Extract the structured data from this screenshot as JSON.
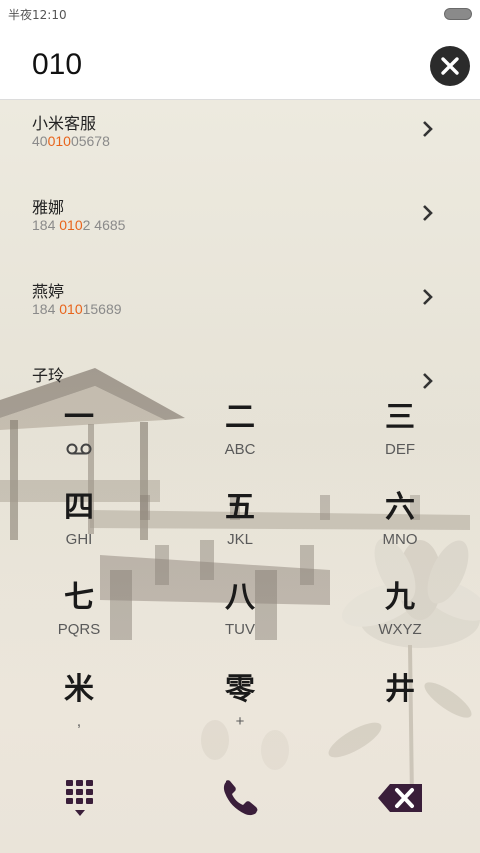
{
  "status_bar": {
    "time": "半夜12:10"
  },
  "dialer": {
    "number": "010"
  },
  "contacts": [
    {
      "name": "小米客服",
      "number_pre": "40",
      "number_hl": "010",
      "number_post": "05678"
    },
    {
      "name": "雅娜",
      "number_pre": "184 ",
      "number_hl": "010",
      "number_post": "2 4685"
    },
    {
      "name": "燕婷",
      "number_pre": "184 ",
      "number_hl": "010",
      "number_post": "15689"
    },
    {
      "name": "子玲",
      "number_pre": "",
      "number_hl": "",
      "number_post": ""
    }
  ],
  "keypad": [
    {
      "glyph": "一",
      "sub": "voicemail-icon"
    },
    {
      "glyph": "二",
      "sub": "ABC"
    },
    {
      "glyph": "三",
      "sub": "DEF"
    },
    {
      "glyph": "四",
      "sub": "GHI"
    },
    {
      "glyph": "五",
      "sub": "JKL"
    },
    {
      "glyph": "六",
      "sub": "MNO"
    },
    {
      "glyph": "七",
      "sub": "PQRS"
    },
    {
      "glyph": "八",
      "sub": "TUV"
    },
    {
      "glyph": "九",
      "sub": "WXYZ"
    },
    {
      "glyph": "米",
      "sub": ","
    },
    {
      "glyph": "零",
      "sub": "+"
    },
    {
      "glyph": "井",
      "sub": ""
    }
  ],
  "bottom_bar": {
    "keypad_icon": "dialpad-icon",
    "call_icon": "phone-icon",
    "backspace_icon": "backspace-icon"
  },
  "colors": {
    "accent": "#e8641c",
    "icon_dark": "#3a1e3a"
  }
}
